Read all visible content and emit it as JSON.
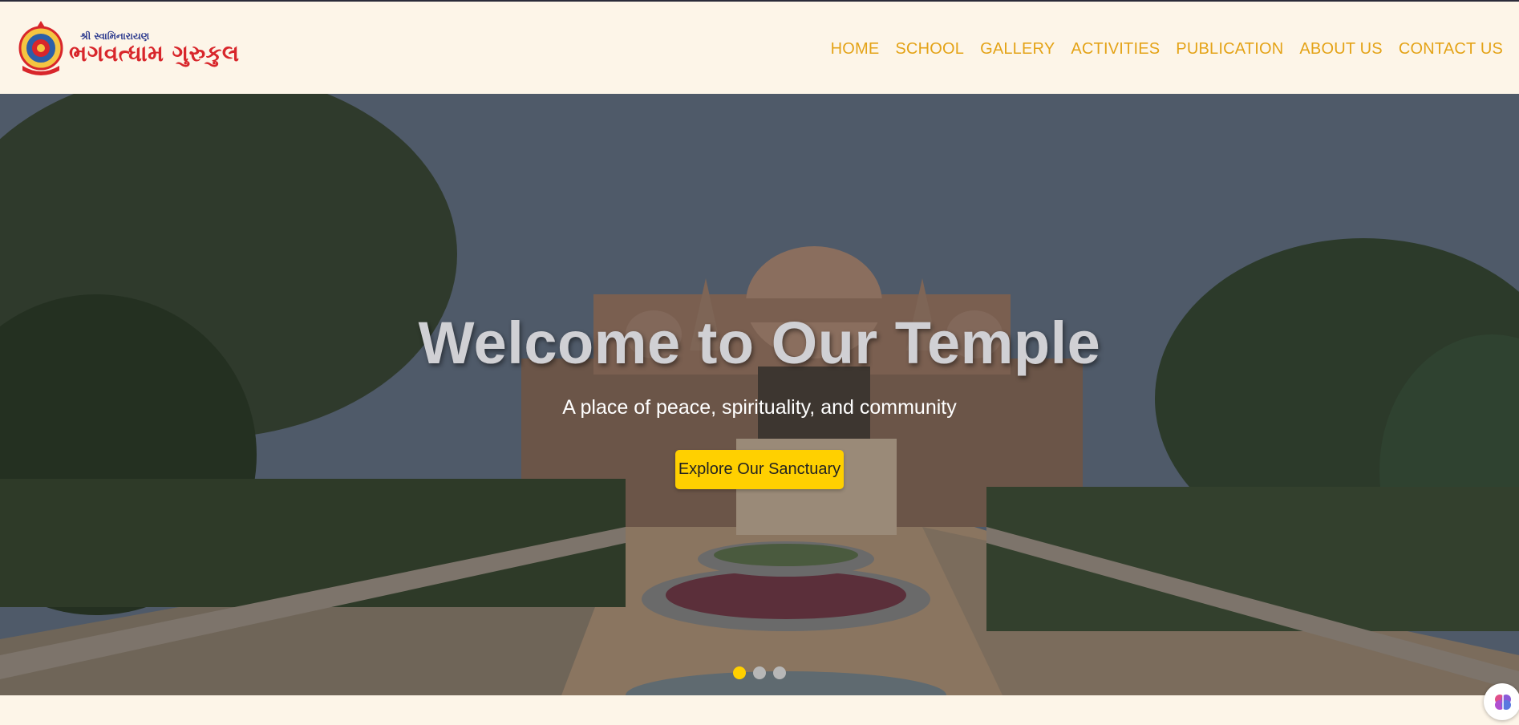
{
  "brand": {
    "small_text": "શ્રી સ્વામિનારાયણ",
    "name": "ભગવત્ધામ ગુરુકુલ",
    "logo_icon": "temple-emblem-icon",
    "colors": {
      "name": "#d8262b",
      "small": "#2c3a8e"
    }
  },
  "nav": {
    "items": [
      {
        "label": "HOME"
      },
      {
        "label": "SCHOOL"
      },
      {
        "label": "GALLERY"
      },
      {
        "label": "ACTIVITIES"
      },
      {
        "label": "PUBLICATION"
      },
      {
        "label": "ABOUT US"
      },
      {
        "label": "CONTACT US"
      }
    ],
    "color": "#e4a317"
  },
  "hero": {
    "title": "Welcome to Our Temple",
    "subtitle": "A place of peace, spirituality, and community",
    "button_label": "Explore Our Sanctuary",
    "button_color": "#ffd000",
    "slides": {
      "count": 3,
      "active": 1
    }
  },
  "floating_widget": {
    "icon": "brain-icon"
  }
}
